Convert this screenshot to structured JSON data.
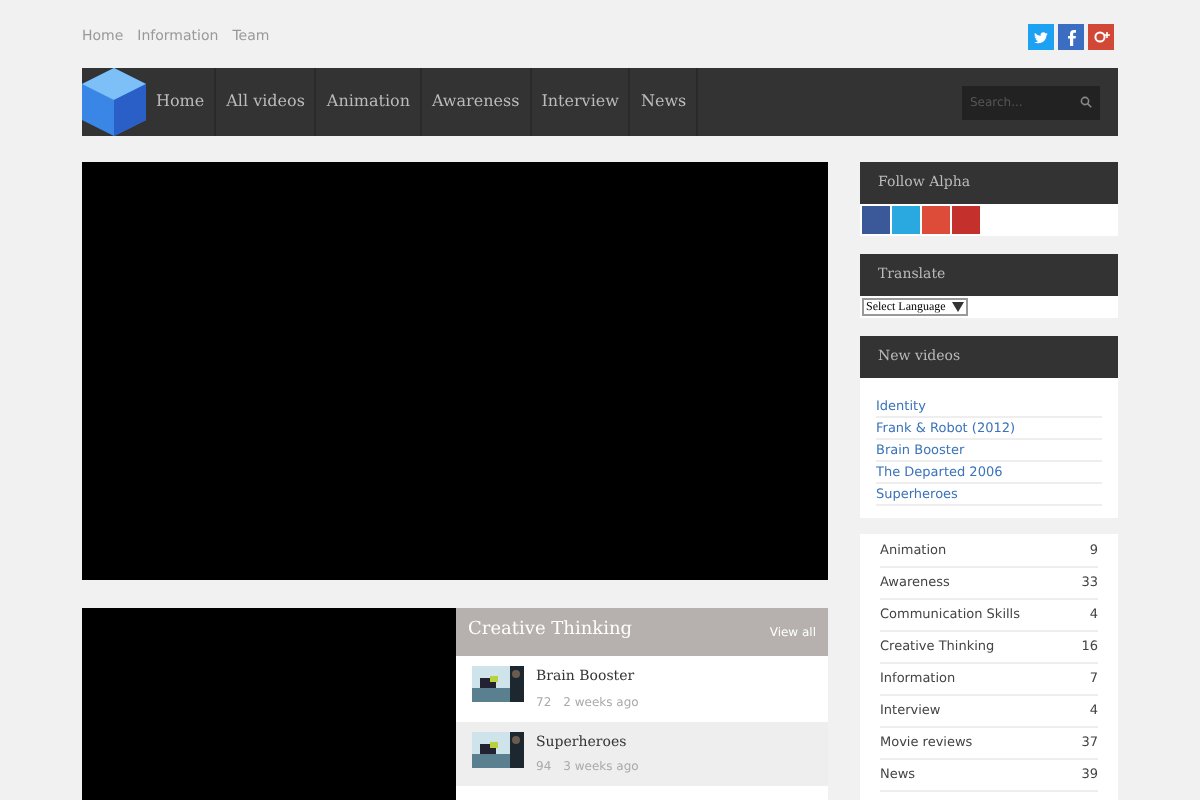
{
  "top_links": [
    "Home",
    "Information",
    "Team"
  ],
  "nav": {
    "items": [
      "Home",
      "All videos",
      "Animation",
      "Awareness",
      "Interview",
      "News"
    ],
    "search": {
      "placeholder": "Search..."
    }
  },
  "featured": {
    "kind": "video"
  },
  "category_panel": {
    "title": "Creative Thinking",
    "view_all": "View all",
    "videos": [
      {
        "title": "Brain Booster",
        "views": "72",
        "time": "2 weeks ago",
        "selected": false
      },
      {
        "title": "Superheroes",
        "views": "94",
        "time": "3 weeks ago",
        "selected": true
      }
    ]
  },
  "sidebar": {
    "follow": {
      "title": "Follow Alpha"
    },
    "translate": {
      "title": "Translate",
      "select": "Select Language"
    },
    "new_videos": {
      "title": "New videos",
      "items": [
        "Identity",
        "Frank & Robot (2012)",
        "Brain Booster",
        "The Departed 2006",
        "Superheroes"
      ]
    },
    "categories": [
      {
        "name": "Animation",
        "count": "9"
      },
      {
        "name": "Awareness",
        "count": "33"
      },
      {
        "name": "Communication Skills",
        "count": "4"
      },
      {
        "name": "Creative Thinking",
        "count": "16"
      },
      {
        "name": "Information",
        "count": "7"
      },
      {
        "name": "Interview",
        "count": "4"
      },
      {
        "name": "Movie reviews",
        "count": "37"
      },
      {
        "name": "News",
        "count": "39"
      }
    ]
  }
}
